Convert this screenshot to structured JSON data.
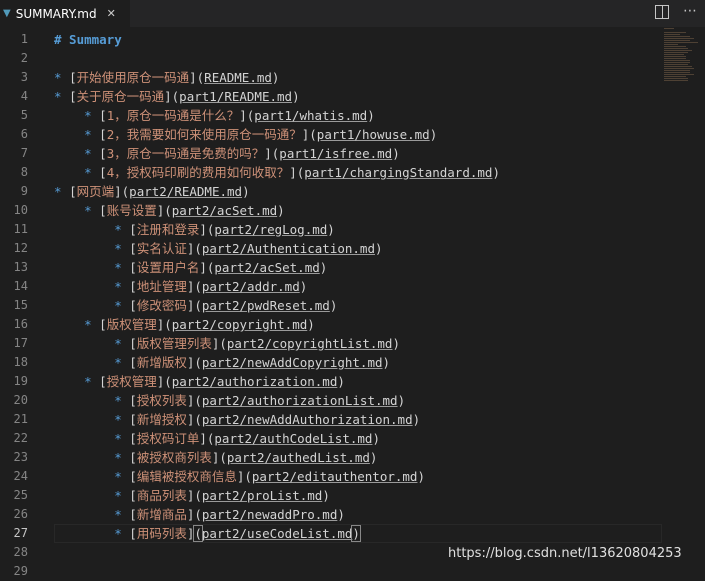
{
  "tab": {
    "filename": "SUMMARY.md",
    "close": "✕"
  },
  "tab_actions": {
    "split_icon": "split-editor-icon",
    "more_icon": "more-actions-icon",
    "more_glyph": "⋯"
  },
  "lines": [
    {
      "num": "1",
      "indent": "",
      "bullet": "",
      "label": "",
      "url": "",
      "heading": "# Summary"
    },
    {
      "num": "2",
      "indent": "",
      "bullet": "",
      "label": "",
      "url": "",
      "heading": ""
    },
    {
      "num": "3",
      "indent": "",
      "bullet": "* ",
      "label": "开始使用原仓一码通",
      "url": "README.md",
      "heading": ""
    },
    {
      "num": "4",
      "indent": "",
      "bullet": "* ",
      "label": "关于原仓一码通",
      "url": "part1/README.md",
      "heading": ""
    },
    {
      "num": "5",
      "indent": "    ",
      "bullet": "* ",
      "label": "1，原仓一码通是什么？",
      "url": "part1/whatis.md",
      "heading": ""
    },
    {
      "num": "6",
      "indent": "    ",
      "bullet": "* ",
      "label": "2，我需要如何来使用原仓一码通？",
      "url": "part1/howuse.md",
      "heading": ""
    },
    {
      "num": "7",
      "indent": "    ",
      "bullet": "* ",
      "label": "3，原仓一码通是免费的吗？",
      "url": "part1/isfree.md",
      "heading": ""
    },
    {
      "num": "8",
      "indent": "    ",
      "bullet": "* ",
      "label": "4，授权码印刷的费用如何收取？",
      "url": "part1/chargingStandard.md",
      "heading": ""
    },
    {
      "num": "9",
      "indent": "",
      "bullet": "* ",
      "label": "网页端",
      "url": "part2/README.md",
      "heading": ""
    },
    {
      "num": "10",
      "indent": "    ",
      "bullet": "* ",
      "label": "账号设置",
      "url": "part2/acSet.md",
      "heading": ""
    },
    {
      "num": "11",
      "indent": "        ",
      "bullet": "* ",
      "label": "注册和登录",
      "url": "part2/regLog.md",
      "heading": ""
    },
    {
      "num": "12",
      "indent": "        ",
      "bullet": "* ",
      "label": "实名认证",
      "url": "part2/Authentication.md",
      "heading": ""
    },
    {
      "num": "13",
      "indent": "        ",
      "bullet": "* ",
      "label": "设置用户名",
      "url": "part2/acSet.md",
      "heading": ""
    },
    {
      "num": "14",
      "indent": "        ",
      "bullet": "* ",
      "label": "地址管理",
      "url": "part2/addr.md",
      "heading": ""
    },
    {
      "num": "15",
      "indent": "        ",
      "bullet": "* ",
      "label": "修改密码",
      "url": "part2/pwdReset.md",
      "heading": ""
    },
    {
      "num": "16",
      "indent": "    ",
      "bullet": "* ",
      "label": "版权管理",
      "url": "part2/copyright.md",
      "heading": ""
    },
    {
      "num": "17",
      "indent": "        ",
      "bullet": "* ",
      "label": "版权管理列表",
      "url": "part2/copyrightList.md",
      "heading": ""
    },
    {
      "num": "18",
      "indent": "        ",
      "bullet": "* ",
      "label": "新增版权",
      "url": "part2/newAddCopyright.md",
      "heading": ""
    },
    {
      "num": "19",
      "indent": "    ",
      "bullet": "* ",
      "label": "授权管理",
      "url": "part2/authorization.md",
      "heading": ""
    },
    {
      "num": "20",
      "indent": "        ",
      "bullet": "* ",
      "label": "授权列表",
      "url": "part2/authorizationList.md",
      "heading": ""
    },
    {
      "num": "21",
      "indent": "        ",
      "bullet": "* ",
      "label": "新增授权",
      "url": "part2/newAddAuthorization.md",
      "heading": ""
    },
    {
      "num": "22",
      "indent": "        ",
      "bullet": "* ",
      "label": "授权码订单",
      "url": "part2/authCodeList.md",
      "heading": ""
    },
    {
      "num": "23",
      "indent": "        ",
      "bullet": "* ",
      "label": "被授权商列表",
      "url": "part2/authedList.md",
      "heading": ""
    },
    {
      "num": "24",
      "indent": "        ",
      "bullet": "* ",
      "label": "编辑被授权商信息",
      "url": "part2/editauthentor.md",
      "heading": ""
    },
    {
      "num": "25",
      "indent": "        ",
      "bullet": "* ",
      "label": "商品列表",
      "url": "part2/proList.md",
      "heading": ""
    },
    {
      "num": "26",
      "indent": "        ",
      "bullet": "* ",
      "label": "新增商品",
      "url": "part2/newaddPro.md",
      "heading": ""
    },
    {
      "num": "27",
      "indent": "        ",
      "bullet": "* ",
      "label": "用码列表",
      "url": "part2/useCodeList.md",
      "heading": ""
    },
    {
      "num": "28",
      "indent": "",
      "bullet": "",
      "label": "",
      "url": "",
      "heading": ""
    },
    {
      "num": "29",
      "indent": "",
      "bullet": "",
      "label": "",
      "url": "",
      "heading": ""
    }
  ],
  "current_line": "27",
  "watermark": "https://blog.csdn.net/l13620804253",
  "colors": {
    "background": "#1e1e1e",
    "heading": "#569cd6",
    "link_text": "#ce9178",
    "punctuation": "#d4d4d4",
    "line_number": "#858585"
  }
}
